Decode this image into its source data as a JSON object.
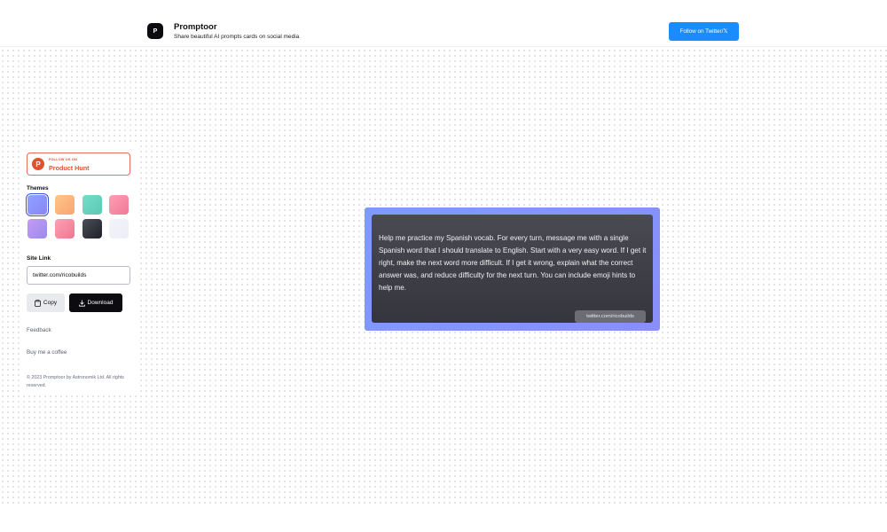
{
  "header": {
    "logo_glyph": "P",
    "title": "Promptoor",
    "subtitle": "Share beautiful AI prompts cards on social media",
    "follow_button": "Follow on Twitter/𝕏"
  },
  "sidebar": {
    "product_hunt": {
      "small": "FOLLOW US ON",
      "big": "Product Hunt",
      "glyph": "P",
      "color": "#da552f"
    },
    "themes_label": "Themes",
    "themes": [
      {
        "name": "indigo",
        "from": "#8fa2ff",
        "to": "#8886f5",
        "selected": true
      },
      {
        "name": "peach",
        "from": "#ffc58a",
        "to": "#f9a56f",
        "selected": false
      },
      {
        "name": "mint",
        "from": "#6fe0c8",
        "to": "#5fc7b4",
        "selected": false
      },
      {
        "name": "rose",
        "from": "#ff9db3",
        "to": "#f07a98",
        "selected": false
      },
      {
        "name": "lavender",
        "from": "#c49bf5",
        "to": "#9b8bea",
        "selected": false
      },
      {
        "name": "pink",
        "from": "#ff9fb2",
        "to": "#ee7893",
        "selected": false
      },
      {
        "name": "charcoal",
        "from": "#4b4f58",
        "to": "#1e2027",
        "selected": false
      },
      {
        "name": "frost",
        "from": "#f3f4fa",
        "to": "#eceef6",
        "selected": false
      }
    ],
    "site_link_label": "Site Link",
    "site_link_value": "twitter.com/ricobuilds",
    "copy_button": "Copy",
    "download_button": "Download",
    "feedback": "Feedback",
    "coffee": "Buy me a coffee",
    "copyright": "© 2023 Promptoor by Astronomik Ltd. All rights reserved."
  },
  "card": {
    "prompt": "Help me practice my Spanish vocab. For every turn, message me with a single Spanish word that I should translate to English. Start with a very easy word. If I get it right, make the next word more difficult. If I get it wrong, explain what the correct answer was, and reduce difficulty for the next turn. You can include emoji hints to help me.",
    "watermark": "twitter.com/ricobuilds"
  }
}
